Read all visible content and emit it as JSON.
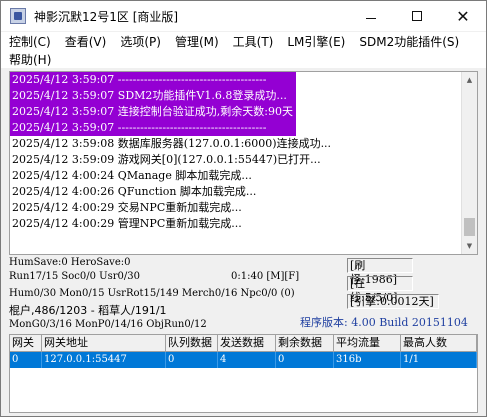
{
  "window": {
    "title": "神影沉默12号1区 [商业版]",
    "accent": "#9400d3",
    "selection_color": "#0078d7"
  },
  "menu": {
    "row1": [
      "控制(C)",
      "查看(V)",
      "选项(P)",
      "管理(M)",
      "工具(T)",
      "LM引擎(E)",
      "SDM2功能插件(S)"
    ],
    "row2": [
      "帮助(H)"
    ]
  },
  "log": {
    "lines": [
      {
        "text": "2025/4/12 3:59:07 ----------------------------------------",
        "highlight": true
      },
      {
        "text": "2025/4/12 3:59:07 SDM2功能插件V1.6.8登录成功...",
        "highlight": true
      },
      {
        "text": "2025/4/12 3:59:07 连接控制台验证成功,剩余天数:90天",
        "highlight": true
      },
      {
        "text": "2025/4/12 3:59:07 ----------------------------------------",
        "highlight": true
      },
      {
        "text": "2025/4/12 3:59:08 数据库服务器(127.0.0.1:6000)连接成功...",
        "highlight": false
      },
      {
        "text": "2025/4/12 3:59:09 游戏网关[0](127.0.0.1:55447)已打开...",
        "highlight": false
      },
      {
        "text": "2025/4/12 4:00:24 QManage 脚本加载完成...",
        "highlight": false
      },
      {
        "text": "2025/4/12 4:00:26 QFunction 脚本加载完成...",
        "highlight": false
      },
      {
        "text": "2025/4/12 4:00:29 交易NPC重新加载完成...",
        "highlight": false
      },
      {
        "text": "2025/4/12 4:00:29 管理NPC重新加载完成...",
        "highlight": false
      }
    ]
  },
  "status": {
    "line1": "HumSave:0 HeroSave:0",
    "line2": "Run17/15 Soc0/0 Usr0/30",
    "time": "0:1:40 [M][F]",
    "line3": "Hum0/30 Mon0/15 UsrRot15/149 Merch0/16 Npc0/0 (0)",
    "line4": "棍户,486/1203 - 稻草人/191/1",
    "line5": "MonG0/3/16 MonP0/14/16 ObjRun0/12",
    "refresh": "[刷怪:1986]",
    "online": "[在线:5/5/0]",
    "engine": "[引擎:0.0012天]",
    "version": "程序版本: 4.00 Build 20151104"
  },
  "table": {
    "headers": [
      "网关",
      "网关地址",
      "队列数据",
      "发送数据",
      "剩余数据",
      "平均流量",
      "最高人数"
    ],
    "rows": [
      [
        "0",
        "127.0.0.1:55447",
        "0",
        "4",
        "0",
        "316b",
        "1/1"
      ]
    ]
  }
}
